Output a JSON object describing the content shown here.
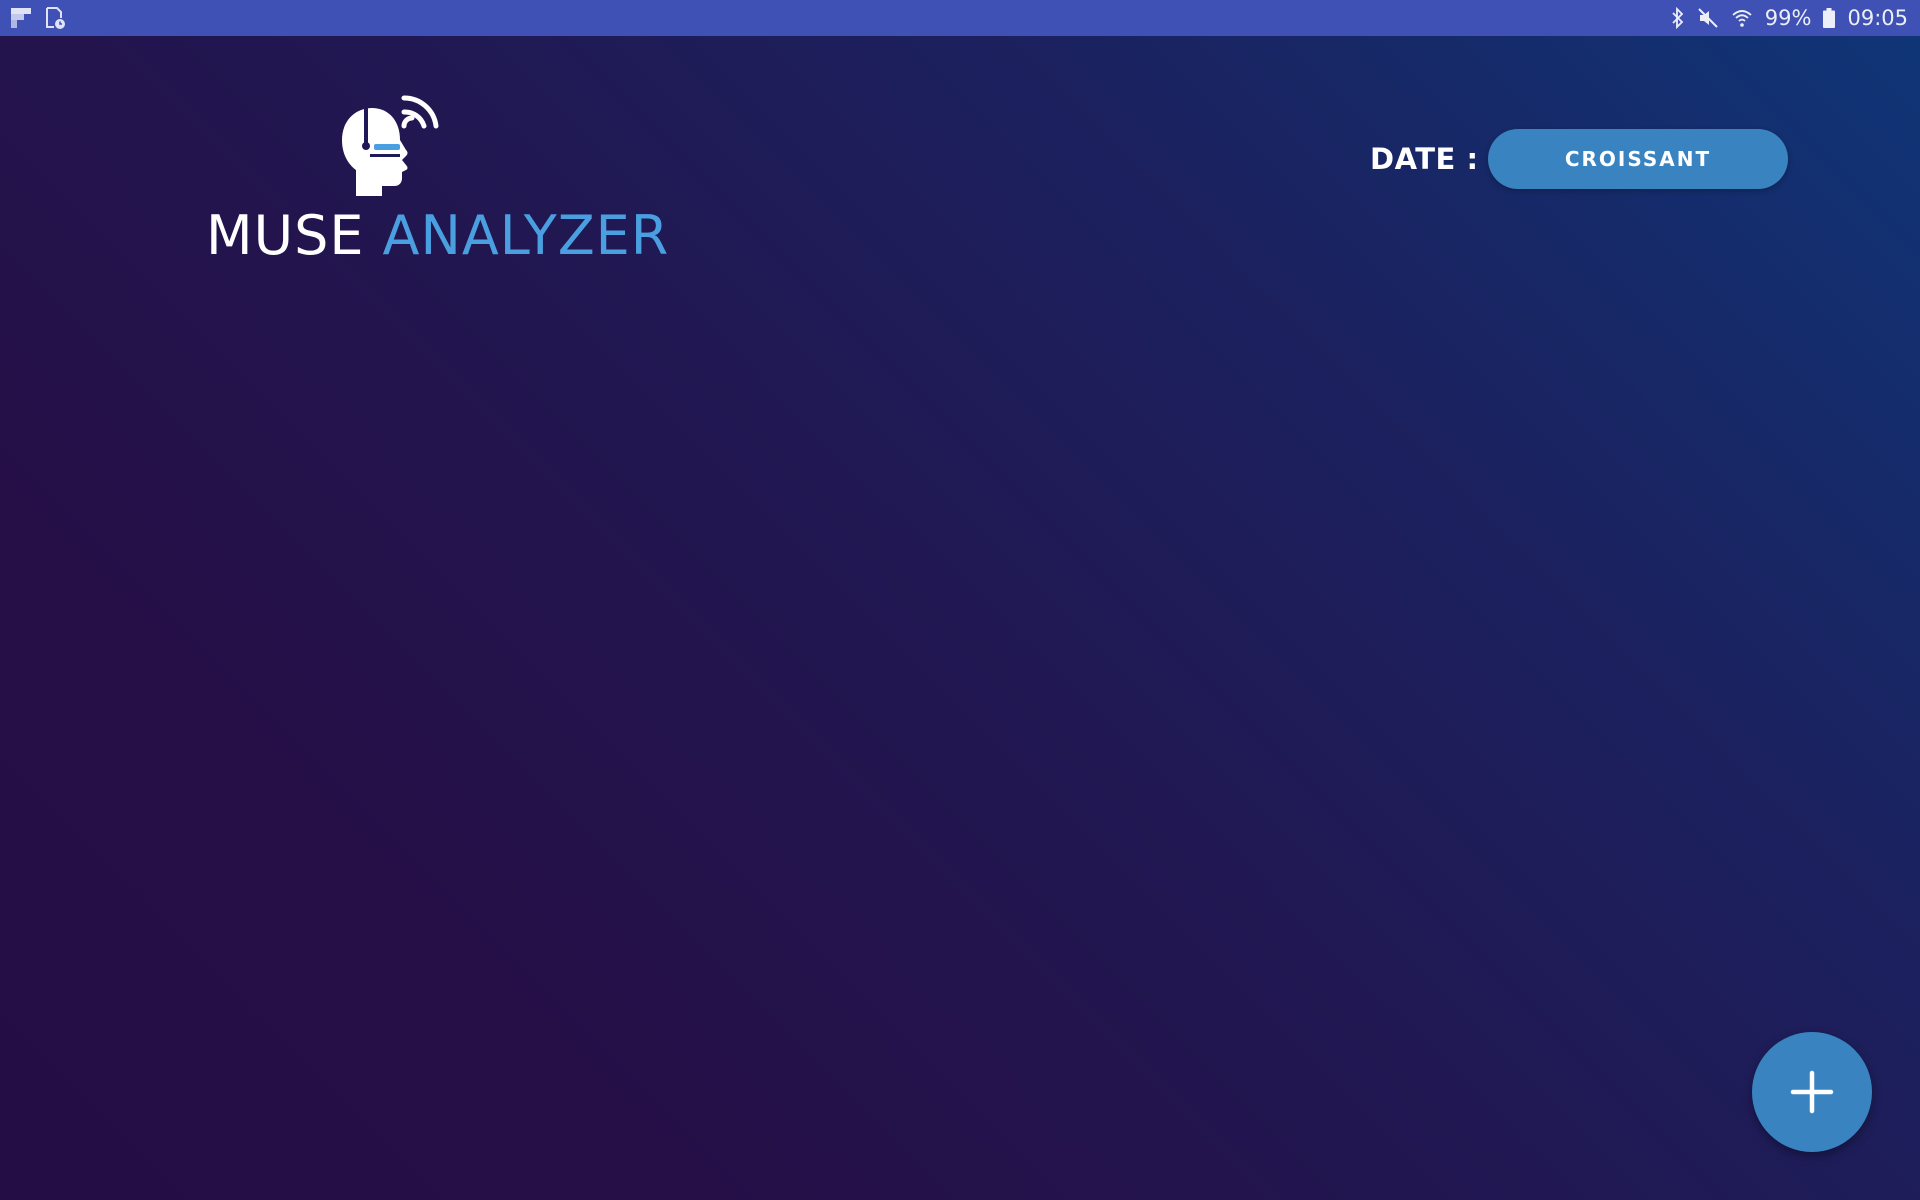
{
  "status_bar": {
    "left_icons": [
      "flipboard-icon",
      "screenshot-icon"
    ],
    "right_icons": [
      "bluetooth-icon",
      "mute-icon",
      "wifi-icon",
      "battery-icon"
    ],
    "battery_text": "99%",
    "time": "09:05"
  },
  "logo": {
    "icon": "head-headset-signal-icon",
    "word1": "MUSE",
    "word2": "ANALYZER"
  },
  "date": {
    "label": "DATE :",
    "button_label": "CROISSANT"
  },
  "fab": {
    "icon": "plus-icon"
  },
  "colors": {
    "status_bar": "#3f51b5",
    "accent": "#3983c0",
    "logo_accent": "#4a9fe0",
    "background_top_right": "#0f3678",
    "background_bottom_left": "#260e46"
  }
}
